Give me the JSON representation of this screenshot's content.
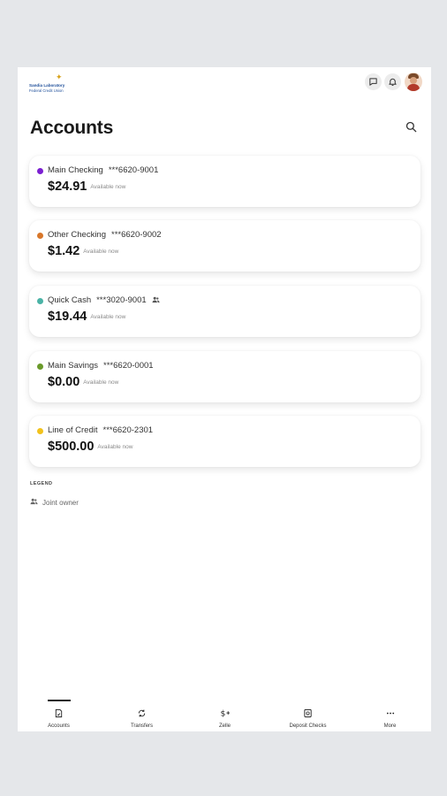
{
  "app": {
    "logo_line1": "Sandia Laboratory",
    "logo_line2": "Federal Credit Union"
  },
  "page": {
    "title": "Accounts"
  },
  "accounts": [
    {
      "name": "Main Checking",
      "number": "***6620-9001",
      "balance": "$24.91",
      "available_label": "Available now",
      "color": "#7b1fd1",
      "joint": false
    },
    {
      "name": "Other Checking",
      "number": "***6620-9002",
      "balance": "$1.42",
      "available_label": "Available now",
      "color": "#d8772a",
      "joint": false
    },
    {
      "name": "Quick Cash",
      "number": "***3020-9001",
      "balance": "$19.44",
      "available_label": "Available now",
      "color": "#4ab3a6",
      "joint": true
    },
    {
      "name": "Main Savings",
      "number": "***6620-0001",
      "balance": "$0.00",
      "available_label": "Available now",
      "color": "#6a9a2a",
      "joint": false
    },
    {
      "name": "Line of Credit",
      "number": "***6620-2301",
      "balance": "$500.00",
      "available_label": "Available now",
      "color": "#f2c21c",
      "joint": false
    }
  ],
  "legend": {
    "title": "LEGEND",
    "joint_owner": "Joint owner"
  },
  "nav": [
    {
      "label": "Accounts",
      "icon": "accounts-icon",
      "active": true
    },
    {
      "label": "Transfers",
      "icon": "transfers-icon",
      "active": false
    },
    {
      "label": "Zelle",
      "icon": "zelle-icon",
      "active": false
    },
    {
      "label": "Deposit Checks",
      "icon": "deposit-checks-icon",
      "active": false
    },
    {
      "label": "More",
      "icon": "more-icon",
      "active": false
    }
  ]
}
